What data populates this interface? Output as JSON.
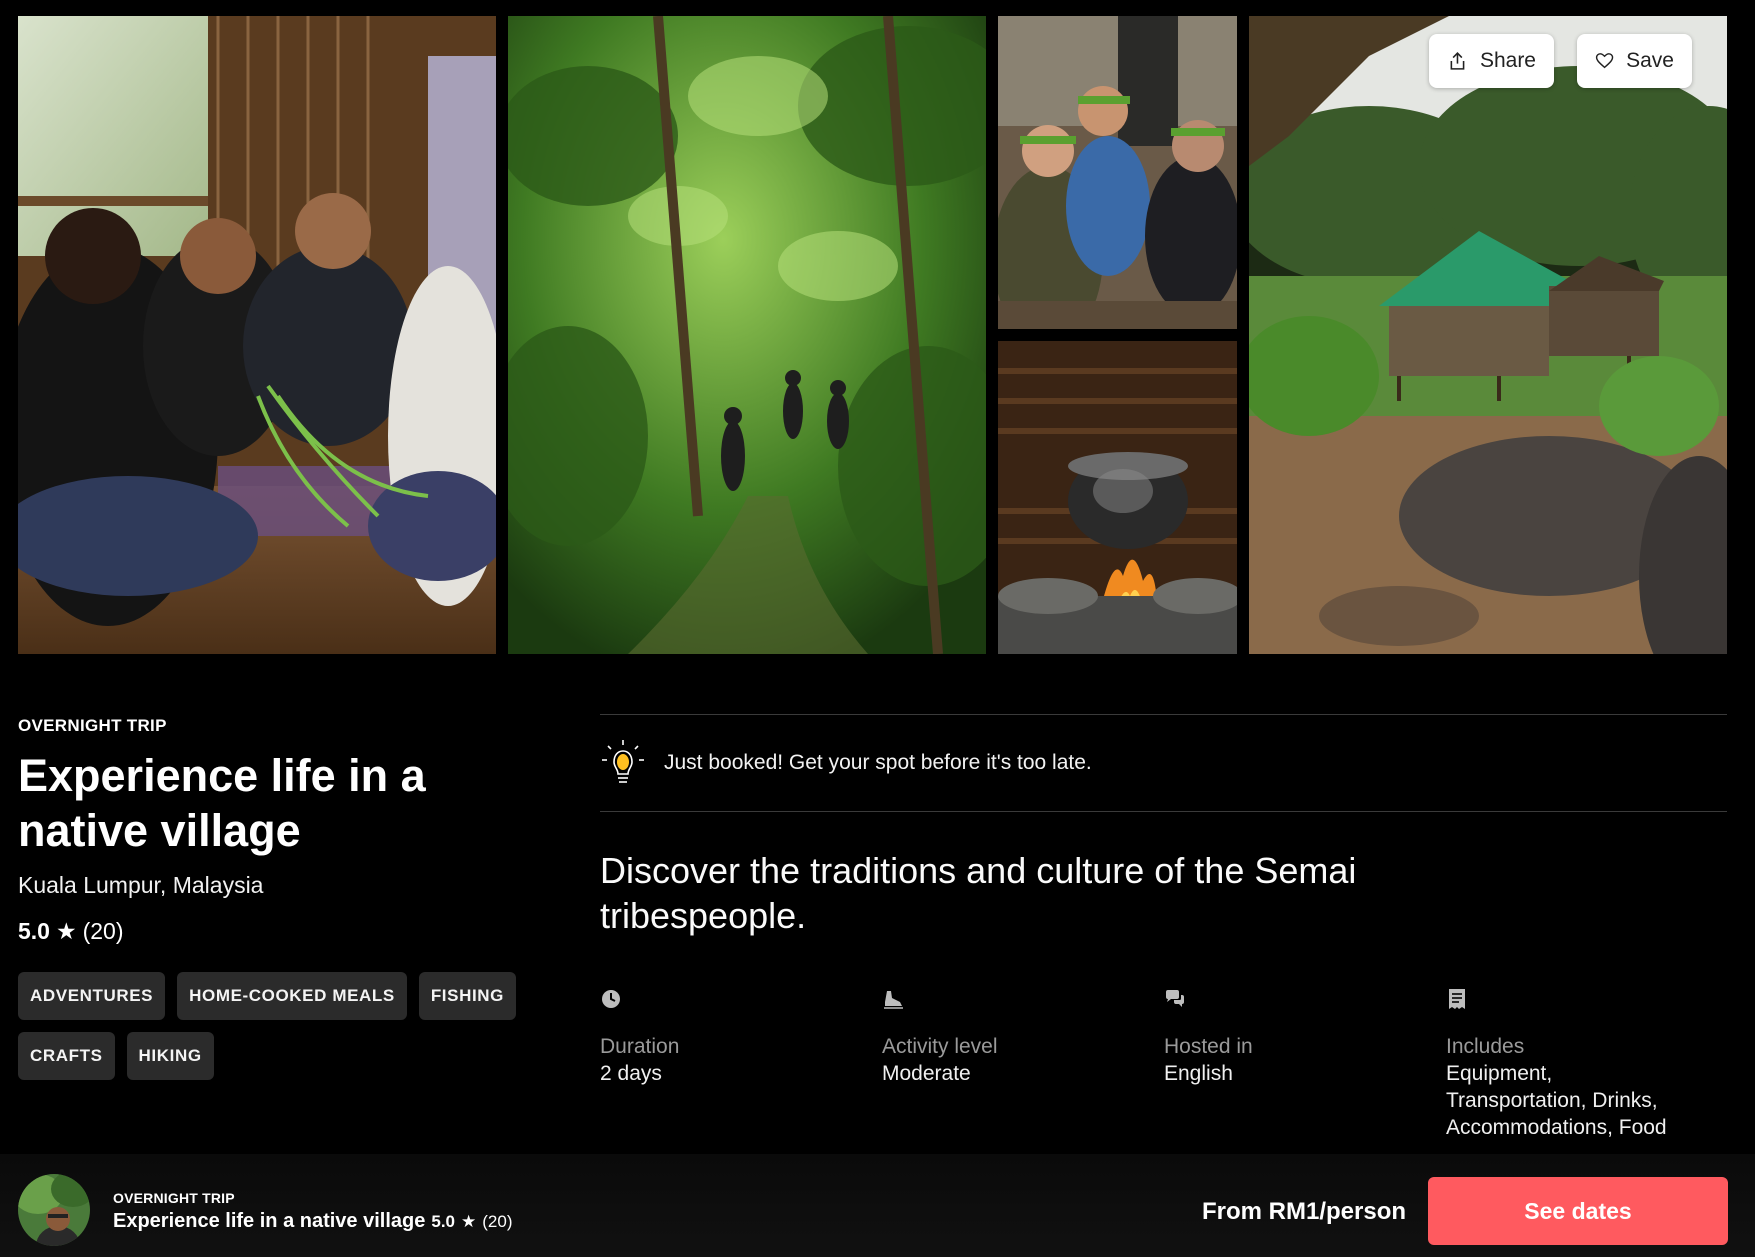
{
  "gallery": {
    "photos": [
      {
        "icon": "crafts-photo",
        "alt": ""
      },
      {
        "icon": "jungle-hike-photo",
        "alt": ""
      },
      {
        "icon": "villagers-photo",
        "alt": ""
      },
      {
        "icon": "cooking-pot-photo",
        "alt": ""
      },
      {
        "icon": "village-hut-photo",
        "alt": ""
      }
    ],
    "share_label": "Share",
    "save_label": "Save"
  },
  "listing": {
    "category": "OVERNIGHT TRIP",
    "title": "Experience life in a native village",
    "location": "Kuala Lumpur, Malaysia",
    "rating": "5.0",
    "review_count": "(20)",
    "tags": [
      "ADVENTURES",
      "HOME-COOKED MEALS",
      "FISHING",
      "CRAFTS",
      "HIKING"
    ]
  },
  "details": {
    "booked_notice": "Just booked! Get your spot before it's too late.",
    "tagline": "Discover the traditions and culture of the Semai tribespeople.",
    "facts": {
      "duration": {
        "label": "Duration",
        "value": "2 days",
        "icon": "clock-icon"
      },
      "activity": {
        "label": "Activity level",
        "value": "Moderate",
        "icon": "hiking-shoe-icon"
      },
      "language": {
        "label": "Hosted in",
        "value": "English",
        "icon": "chat-bubbles-icon"
      },
      "includes": {
        "label": "Includes",
        "value_line1": "Equipment,",
        "value_line2": "Transportation, Drinks,",
        "value_line3": "Accommodations, Food",
        "icon": "receipt-icon"
      }
    }
  },
  "bottom_bar": {
    "category": "OVERNIGHT TRIP",
    "title": "Experience life in a native village",
    "rating": "5.0",
    "review_count": "(20)",
    "price": "From RM1/person",
    "cta_label": "See dates"
  },
  "colors": {
    "background": "#000000",
    "accent": "#ff5a5f",
    "tag_background": "#2b2b2b",
    "muted_text": "#9a9a9a"
  }
}
